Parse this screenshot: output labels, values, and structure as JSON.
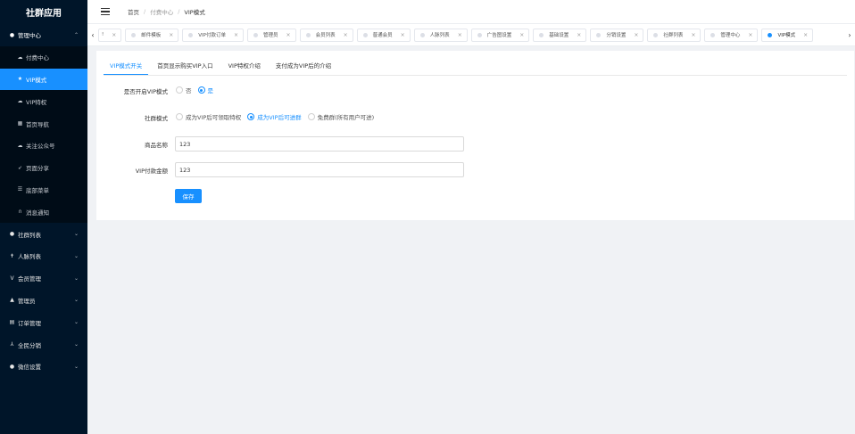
{
  "app": {
    "title": "社群应用"
  },
  "sidebar": {
    "group_main": {
      "label": "管理中心",
      "icon": "circle-icon"
    },
    "sub_items": [
      {
        "label": "付费中心",
        "icon": "cloud-icon",
        "active": false
      },
      {
        "label": "VIP模式",
        "icon": "star-icon",
        "active": true
      },
      {
        "label": "VIP特权",
        "icon": "cloud-icon",
        "active": false
      },
      {
        "label": "首页导航",
        "icon": "grid-icon",
        "active": false
      },
      {
        "label": "关注公众号",
        "icon": "cloud-icon",
        "active": false
      },
      {
        "label": "页面分享",
        "icon": "send-icon",
        "active": false
      },
      {
        "label": "底部菜单",
        "icon": "list-icon",
        "active": false
      },
      {
        "label": "消息通知",
        "icon": "headset-icon",
        "active": false
      }
    ],
    "groups": [
      {
        "label": "社群列表",
        "icon": "chat-icon"
      },
      {
        "label": "人脉列表",
        "icon": "person-icon"
      },
      {
        "label": "会员管理",
        "icon": "vip-icon"
      },
      {
        "label": "管理员",
        "icon": "user-icon"
      },
      {
        "label": "订单管理",
        "icon": "order-icon"
      },
      {
        "label": "全民分销",
        "icon": "share-icon"
      },
      {
        "label": "微信设置",
        "icon": "chat-icon"
      }
    ]
  },
  "header": {
    "breadcrumb": [
      "首页",
      "付费中心",
      "VIP模式"
    ]
  },
  "tabs": [
    {
      "label": "!",
      "active": false,
      "first": true
    },
    {
      "label": "邮件模板",
      "active": false
    },
    {
      "label": "VIP付款订单",
      "active": false
    },
    {
      "label": "管理员",
      "active": false
    },
    {
      "label": "会员列表",
      "active": false
    },
    {
      "label": "普通会员",
      "active": false
    },
    {
      "label": "人脉列表",
      "active": false
    },
    {
      "label": "广告图设置",
      "active": false
    },
    {
      "label": "基础设置",
      "active": false
    },
    {
      "label": "分销设置",
      "active": false
    },
    {
      "label": "社群列表",
      "active": false
    },
    {
      "label": "管理中心",
      "active": false
    },
    {
      "label": "VIP模式",
      "active": true
    }
  ],
  "inner_tabs": [
    "VIP模式开关",
    "首页显示购买VIP入口",
    "VIP特权介绍",
    "支付成为VIP后的介绍"
  ],
  "form": {
    "vip_switch": {
      "label": "是否开启VIP模式",
      "options": [
        "否",
        "是"
      ],
      "selected": "是"
    },
    "group_mode": {
      "label": "社群模式",
      "options": [
        "成为VIP后可领取特权",
        "成为VIP后可进群",
        "免费群(所有用户可进)"
      ],
      "selected": "成为VIP后可进群"
    },
    "product_name": {
      "label": "商品名称",
      "value": "123"
    },
    "vip_amount": {
      "label": "VIP付款金额",
      "value": "123"
    },
    "save_label": "保存"
  },
  "colors": {
    "sidebar_bg": "#001529",
    "accent": "#1890ff"
  }
}
